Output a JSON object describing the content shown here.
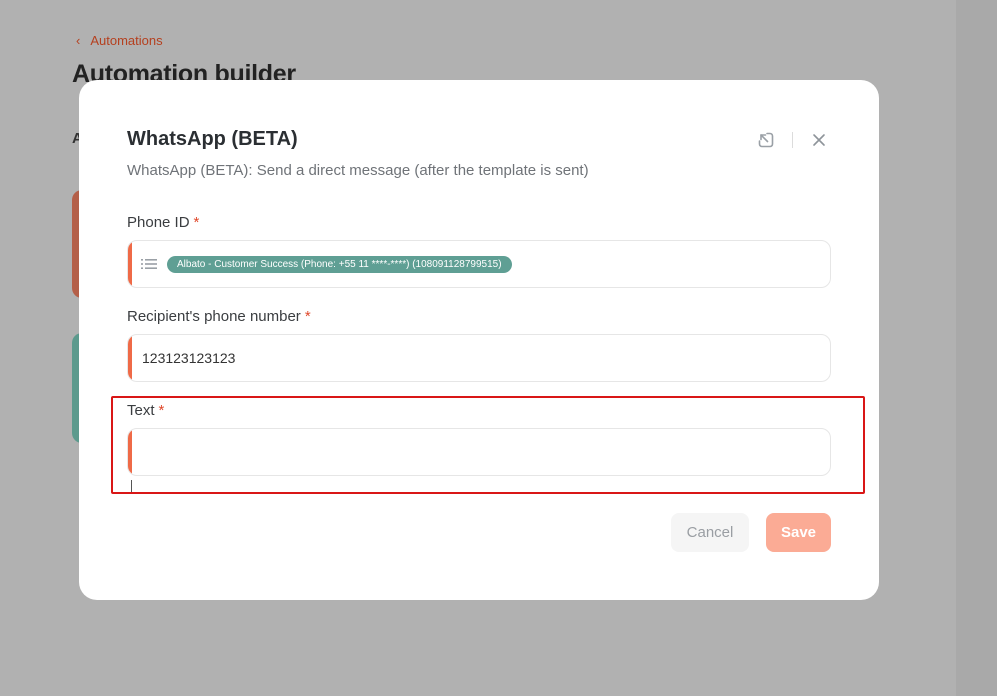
{
  "background": {
    "breadcrumb_label": "Automations",
    "page_title": "Automation builder",
    "section_letter": "A"
  },
  "modal": {
    "title": "WhatsApp (BETA)",
    "subtitle": "WhatsApp (BETA): Send a direct message (after the template is sent)",
    "fields": {
      "phone_id": {
        "label": "Phone ID",
        "required_mark": "*",
        "chip": "Albato - Customer Success (Phone: +55 11 ****-****) (108091128799515)"
      },
      "recipient": {
        "label": "Recipient's phone number",
        "required_mark": "*",
        "value": "123123123123"
      },
      "text": {
        "label": "Text",
        "required_mark": "*",
        "value": ""
      }
    },
    "buttons": {
      "cancel": "Cancel",
      "save": "Save"
    }
  },
  "colors": {
    "accent": "#ef6a47",
    "chip": "#5f9f94",
    "highlight": "#d91616",
    "save_button": "#fbab95",
    "link": "#b5401f"
  },
  "icons": [
    "chevron-left-icon",
    "minimize-icon",
    "close-icon",
    "list-icon"
  ]
}
